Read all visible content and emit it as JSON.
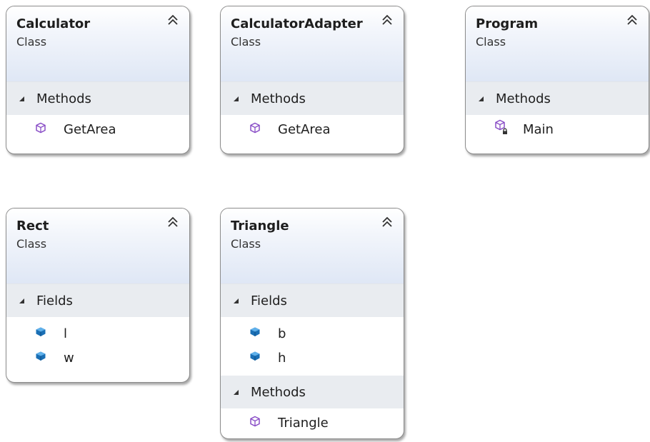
{
  "classes": {
    "calculator": {
      "name": "Calculator",
      "kind": "Class",
      "sections": {
        "methods": "Methods"
      },
      "methods": [
        "GetArea"
      ]
    },
    "calculator_adapter": {
      "name": "CalculatorAdapter",
      "kind": "Class",
      "sections": {
        "methods": "Methods"
      },
      "methods": [
        "GetArea"
      ]
    },
    "program": {
      "name": "Program",
      "kind": "Class",
      "sections": {
        "methods": "Methods"
      },
      "methods": [
        "Main"
      ]
    },
    "rect": {
      "name": "Rect",
      "kind": "Class",
      "sections": {
        "fields": "Fields"
      },
      "fields": [
        "l",
        "w"
      ]
    },
    "triangle": {
      "name": "Triangle",
      "kind": "Class",
      "sections": {
        "fields": "Fields",
        "methods": "Methods"
      },
      "fields": [
        "b",
        "h"
      ],
      "methods": [
        "Triangle"
      ]
    }
  },
  "icons": {
    "collapse": "double-chevron-up-icon",
    "section_toggle": "triangle-expanded-icon",
    "method": "method-cube-icon",
    "private_method": "private-method-icon",
    "field": "field-icon"
  },
  "colors": {
    "method_icon": "#8a4fc7",
    "field_icon": "#1a6fb5",
    "lock": "#333333"
  }
}
